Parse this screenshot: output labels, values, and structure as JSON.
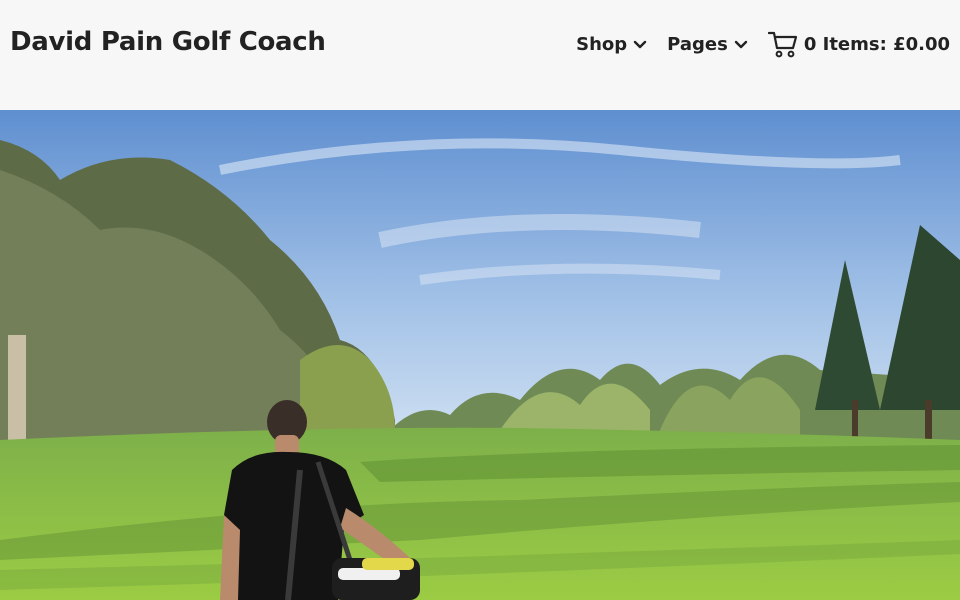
{
  "header": {
    "site_title": "David Pain Golf Coach",
    "nav": [
      {
        "label": "Shop",
        "icon": "chevron-down-icon"
      },
      {
        "label": "Pages",
        "icon": "chevron-down-icon"
      }
    ],
    "cart": {
      "icon": "shopping-cart-icon",
      "label": "0 Items: £0.00"
    }
  },
  "hero": {
    "image_subject": "golfer walking on a golf course fairway"
  },
  "colors": {
    "header_bg": "#f7f7f7",
    "text": "#222222",
    "sky": "#7fa7d8",
    "grass": "#8cc241"
  }
}
